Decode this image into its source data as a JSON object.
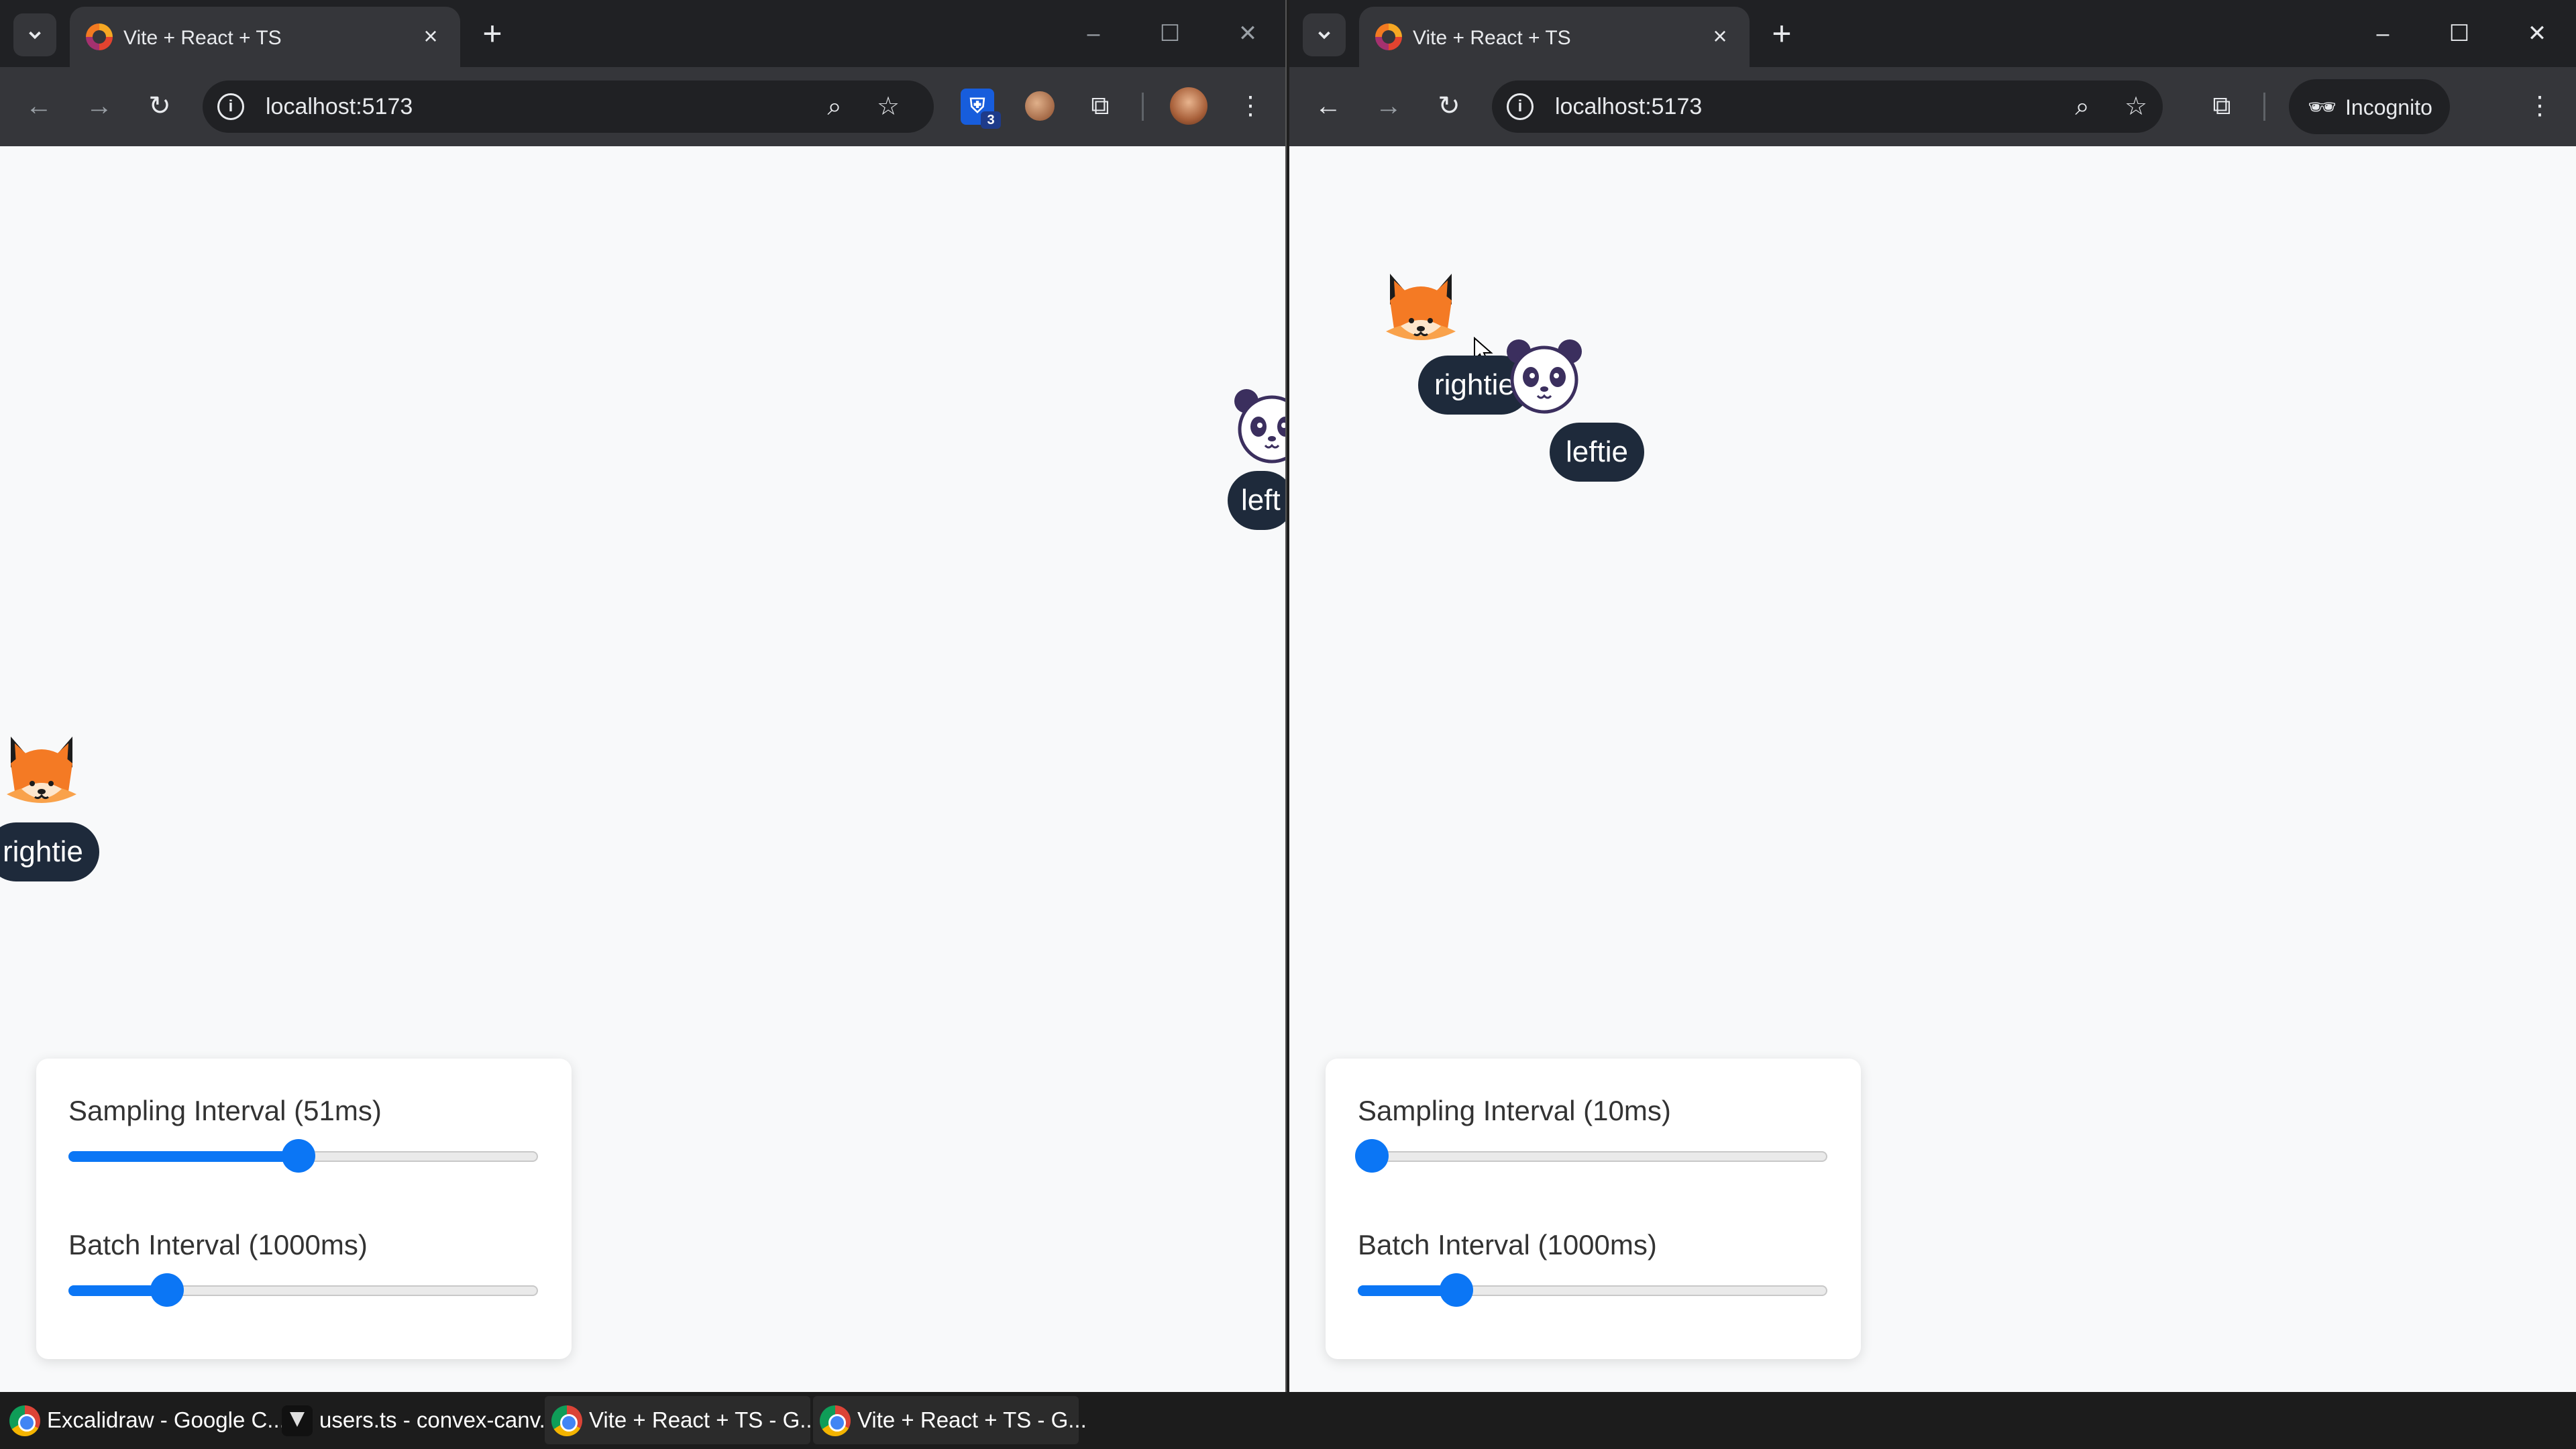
{
  "windows": {
    "left": {
      "tab_title": "Vite + React + TS",
      "url": "localhost:5173",
      "users": {
        "fox_name": "rightie",
        "panda_name": "leftie"
      },
      "panda_label_visible": "left",
      "controls": {
        "sampling_label": "Sampling Interval (51ms)",
        "sampling_value": 0.49,
        "batch_label": "Batch Interval (1000ms)",
        "batch_value": 0.21
      }
    },
    "right": {
      "tab_title": "Vite + React + TS",
      "url": "localhost:5173",
      "incognito_label": "Incognito",
      "users": {
        "fox_name": "rightie",
        "panda_name": "leftie"
      },
      "controls": {
        "sampling_label": "Sampling Interval (10ms)",
        "sampling_value": 0.03,
        "batch_label": "Batch Interval (1000ms)",
        "batch_value": 0.21
      }
    }
  },
  "extensions": {
    "bitwarden_badge": "3"
  },
  "colors": {
    "accent": "#0b76f5",
    "pill": "#1e2a3b",
    "canvas": "#f8f9fa",
    "fox": "#f47a24"
  },
  "icons": {
    "tab_search": "chevron-down-icon",
    "back": "back-arrow-icon",
    "forward": "forward-arrow-icon",
    "reload": "reload-icon",
    "zoom": "zoom-icon",
    "bookmark": "star-icon",
    "extensions": "puzzle-icon",
    "menu": "kebab-menu-icon"
  },
  "taskbar": [
    {
      "label": "Excalidraw - Google C...",
      "icon": "chrome-icon"
    },
    {
      "label": "users.ts - convex-canv...",
      "icon": "cursor-editor-icon"
    },
    {
      "label": "Vite + React + TS - G...",
      "icon": "chrome-icon"
    },
    {
      "label": "Vite + React + TS - G...",
      "icon": "chrome-icon"
    }
  ]
}
